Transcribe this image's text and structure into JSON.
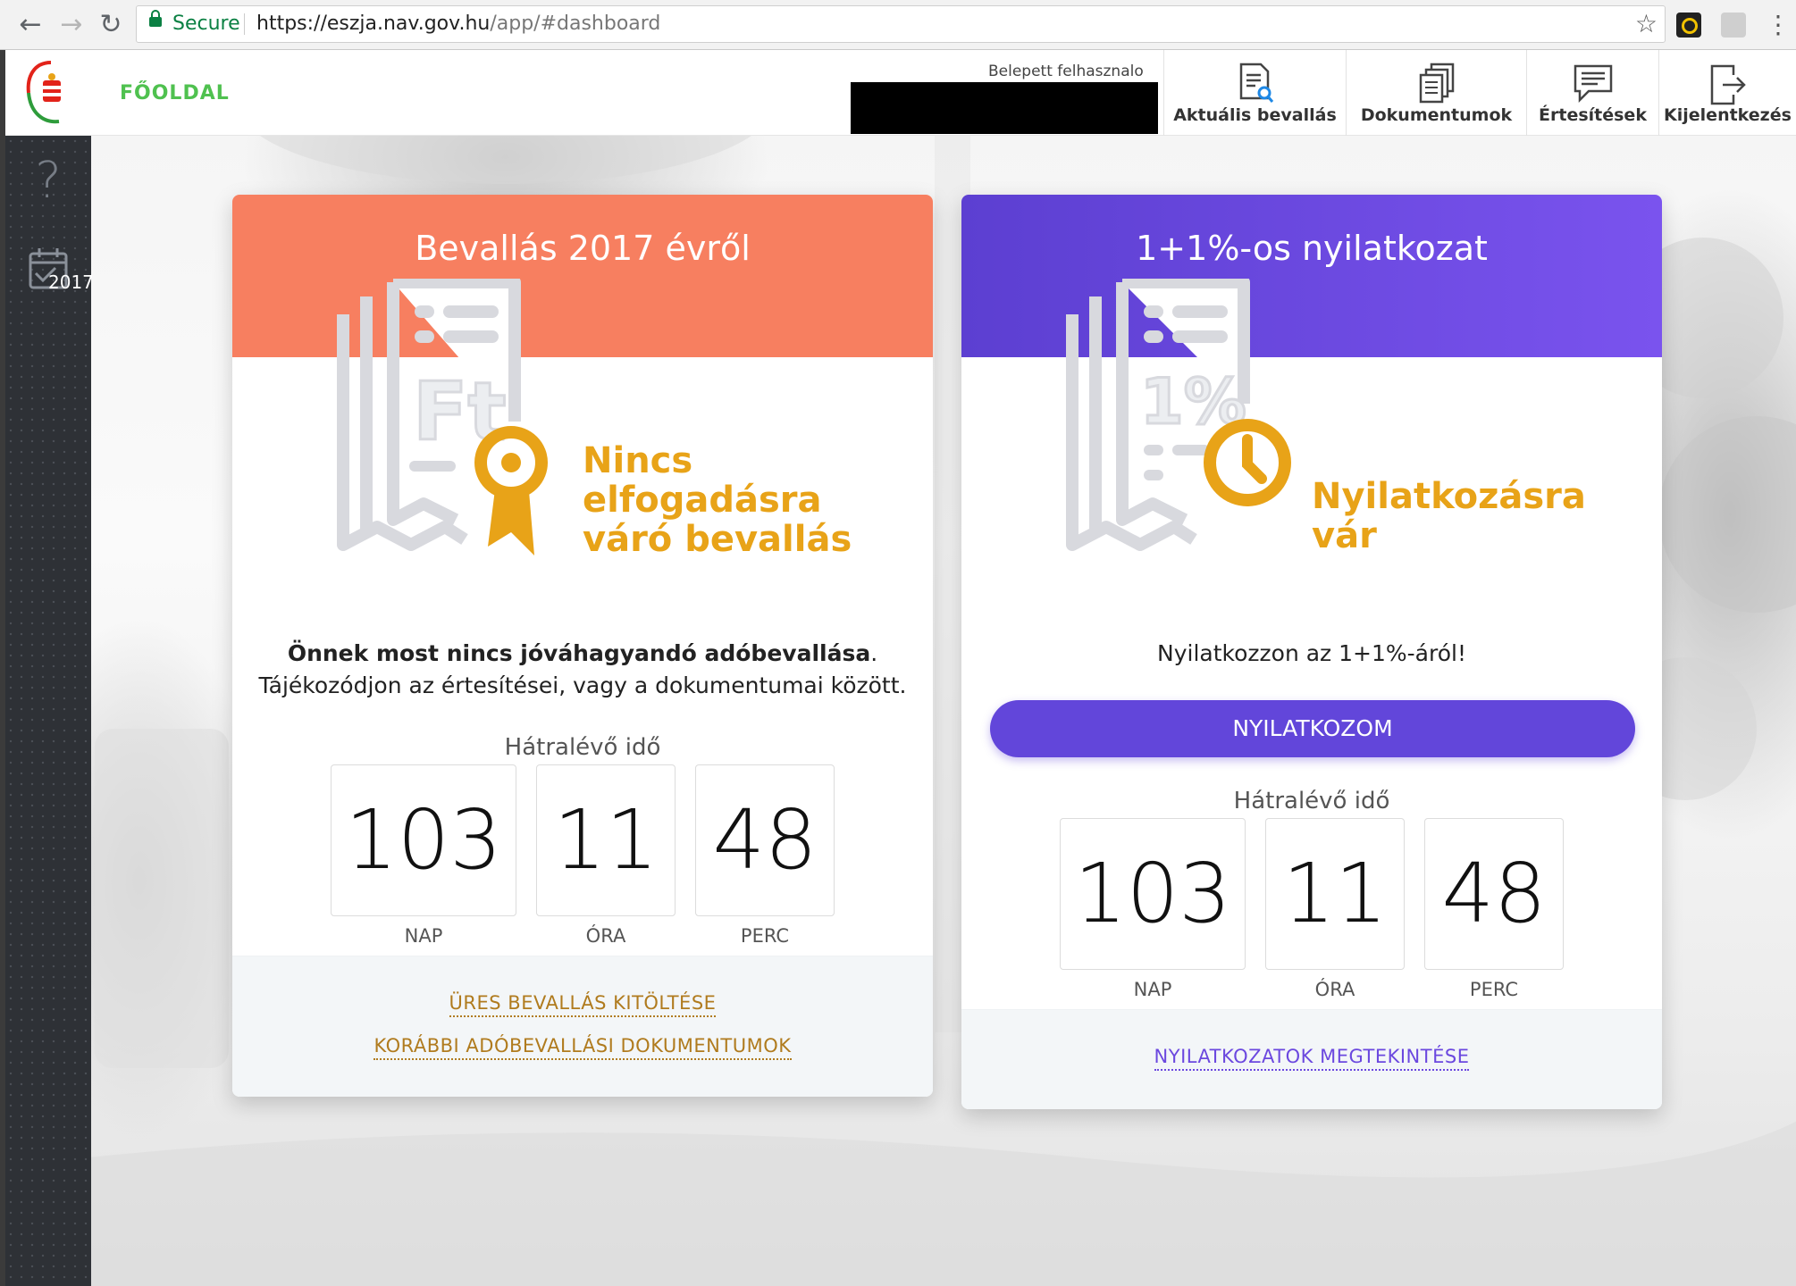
{
  "browser": {
    "secure_label": "Secure",
    "url_host": "https://eszja.nav.gov.hu",
    "url_path": "/app/#dashboard",
    "back_icon": "arrow-left-icon",
    "forward_icon": "arrow-right-icon",
    "reload_icon": "reload-icon",
    "bookmark_icon": "star-icon"
  },
  "header": {
    "home_label": "FŐOLDAL",
    "user_label": "Belepett felhasznalo",
    "buttons": [
      {
        "label": "Aktuális bevallás",
        "icon": "document-search-icon"
      },
      {
        "label": "Dokumentumok",
        "icon": "documents-icon"
      },
      {
        "label": "Értesítések",
        "icon": "message-icon"
      },
      {
        "label": "Kijelentkezés",
        "icon": "logout-icon"
      }
    ]
  },
  "sidebar": {
    "help_glyph": "?",
    "year_label": "2017"
  },
  "cards": {
    "left": {
      "title": "Bevallás 2017 évről",
      "status": "Nincs elfogadásra váró bevallás",
      "message_bold": "Önnek most nincs jóváhagyandó adóbevallása",
      "message_punct": ".",
      "message_line2": "Tájékozódjon az értesítései, vagy a dokumentumai között.",
      "timer_label": "Hátralévő idő",
      "days": "103",
      "hours": "11",
      "minutes": "48",
      "days_label": "NAP",
      "hours_label": "ÓRA",
      "minutes_label": "PERC",
      "link1": "ÜRES BEVALLÁS KITÖLTÉSE",
      "link2": "KORÁBBI ADÓBEVALLÁSI DOKUMENTUMOK",
      "accent": "#f77f60"
    },
    "right": {
      "title": "1+1%-os nyilatkozat",
      "status": "Nyilatkozásra vár",
      "message": "Nyilatkozzon az 1+1%-áról!",
      "button": "NYILATKOZOM",
      "timer_label": "Hátralévő idő",
      "days": "103",
      "hours": "11",
      "minutes": "48",
      "days_label": "NAP",
      "hours_label": "ÓRA",
      "minutes_label": "PERC",
      "link1": "NYILATKOZATOK MEGTEKINTÉSE",
      "accent": "#6246da"
    }
  },
  "colors": {
    "status_gold": "#e8a318",
    "home_green": "#4fc14f",
    "sidebar_dark": "#2e3136"
  }
}
